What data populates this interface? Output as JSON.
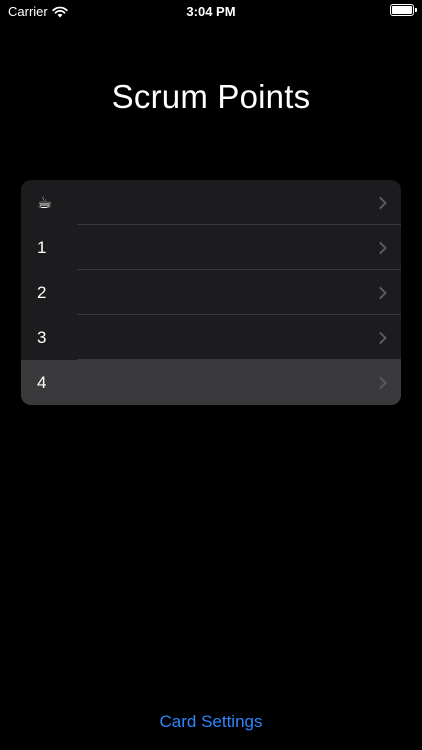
{
  "status_bar": {
    "carrier": "Carrier",
    "time": "3:04 PM",
    "battery_level": 1.0
  },
  "title": "Scrum Points",
  "points": [
    {
      "label": "☕",
      "selected": false
    },
    {
      "label": "1",
      "selected": false
    },
    {
      "label": "2",
      "selected": false
    },
    {
      "label": "3",
      "selected": false
    },
    {
      "label": "4",
      "selected": true
    }
  ],
  "footer": {
    "settings_label": "Card Settings"
  },
  "colors": {
    "background": "#000000",
    "list_bg": "#1c1c1e",
    "selected_row": "#3a3a3c",
    "accent": "#2f86ff"
  }
}
